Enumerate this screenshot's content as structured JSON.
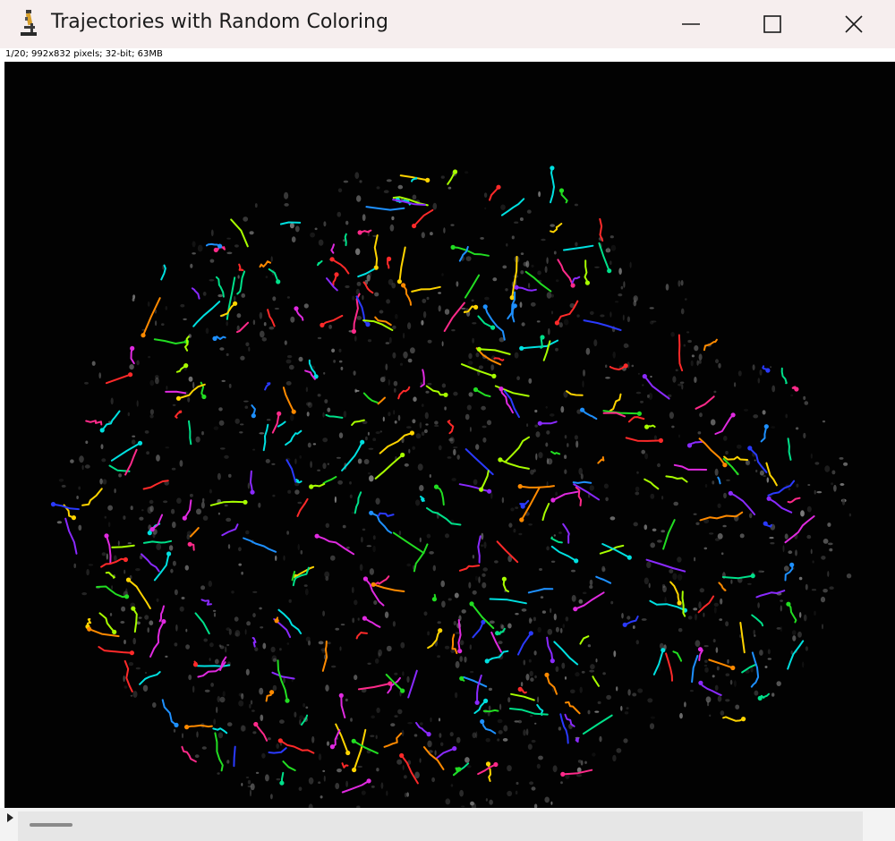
{
  "window": {
    "title": "Trajectories with Random Coloring",
    "icon": "microscope-icon",
    "controls": {
      "minimize": "minimize-icon",
      "maximize": "maximize-icon",
      "close": "close-icon"
    }
  },
  "image_info": "1/20; 992x832 pixels; 32-bit; 63MB",
  "canvas": {
    "background": "#020202",
    "content": "cell nucleus with colored particle trajectories"
  },
  "slice_navigator": {
    "play_icon": "play-icon",
    "current_slice": 1,
    "total_slices": 20
  },
  "colors": {
    "titlebar": "#f6eeee",
    "canvas_bg": "#020202"
  }
}
